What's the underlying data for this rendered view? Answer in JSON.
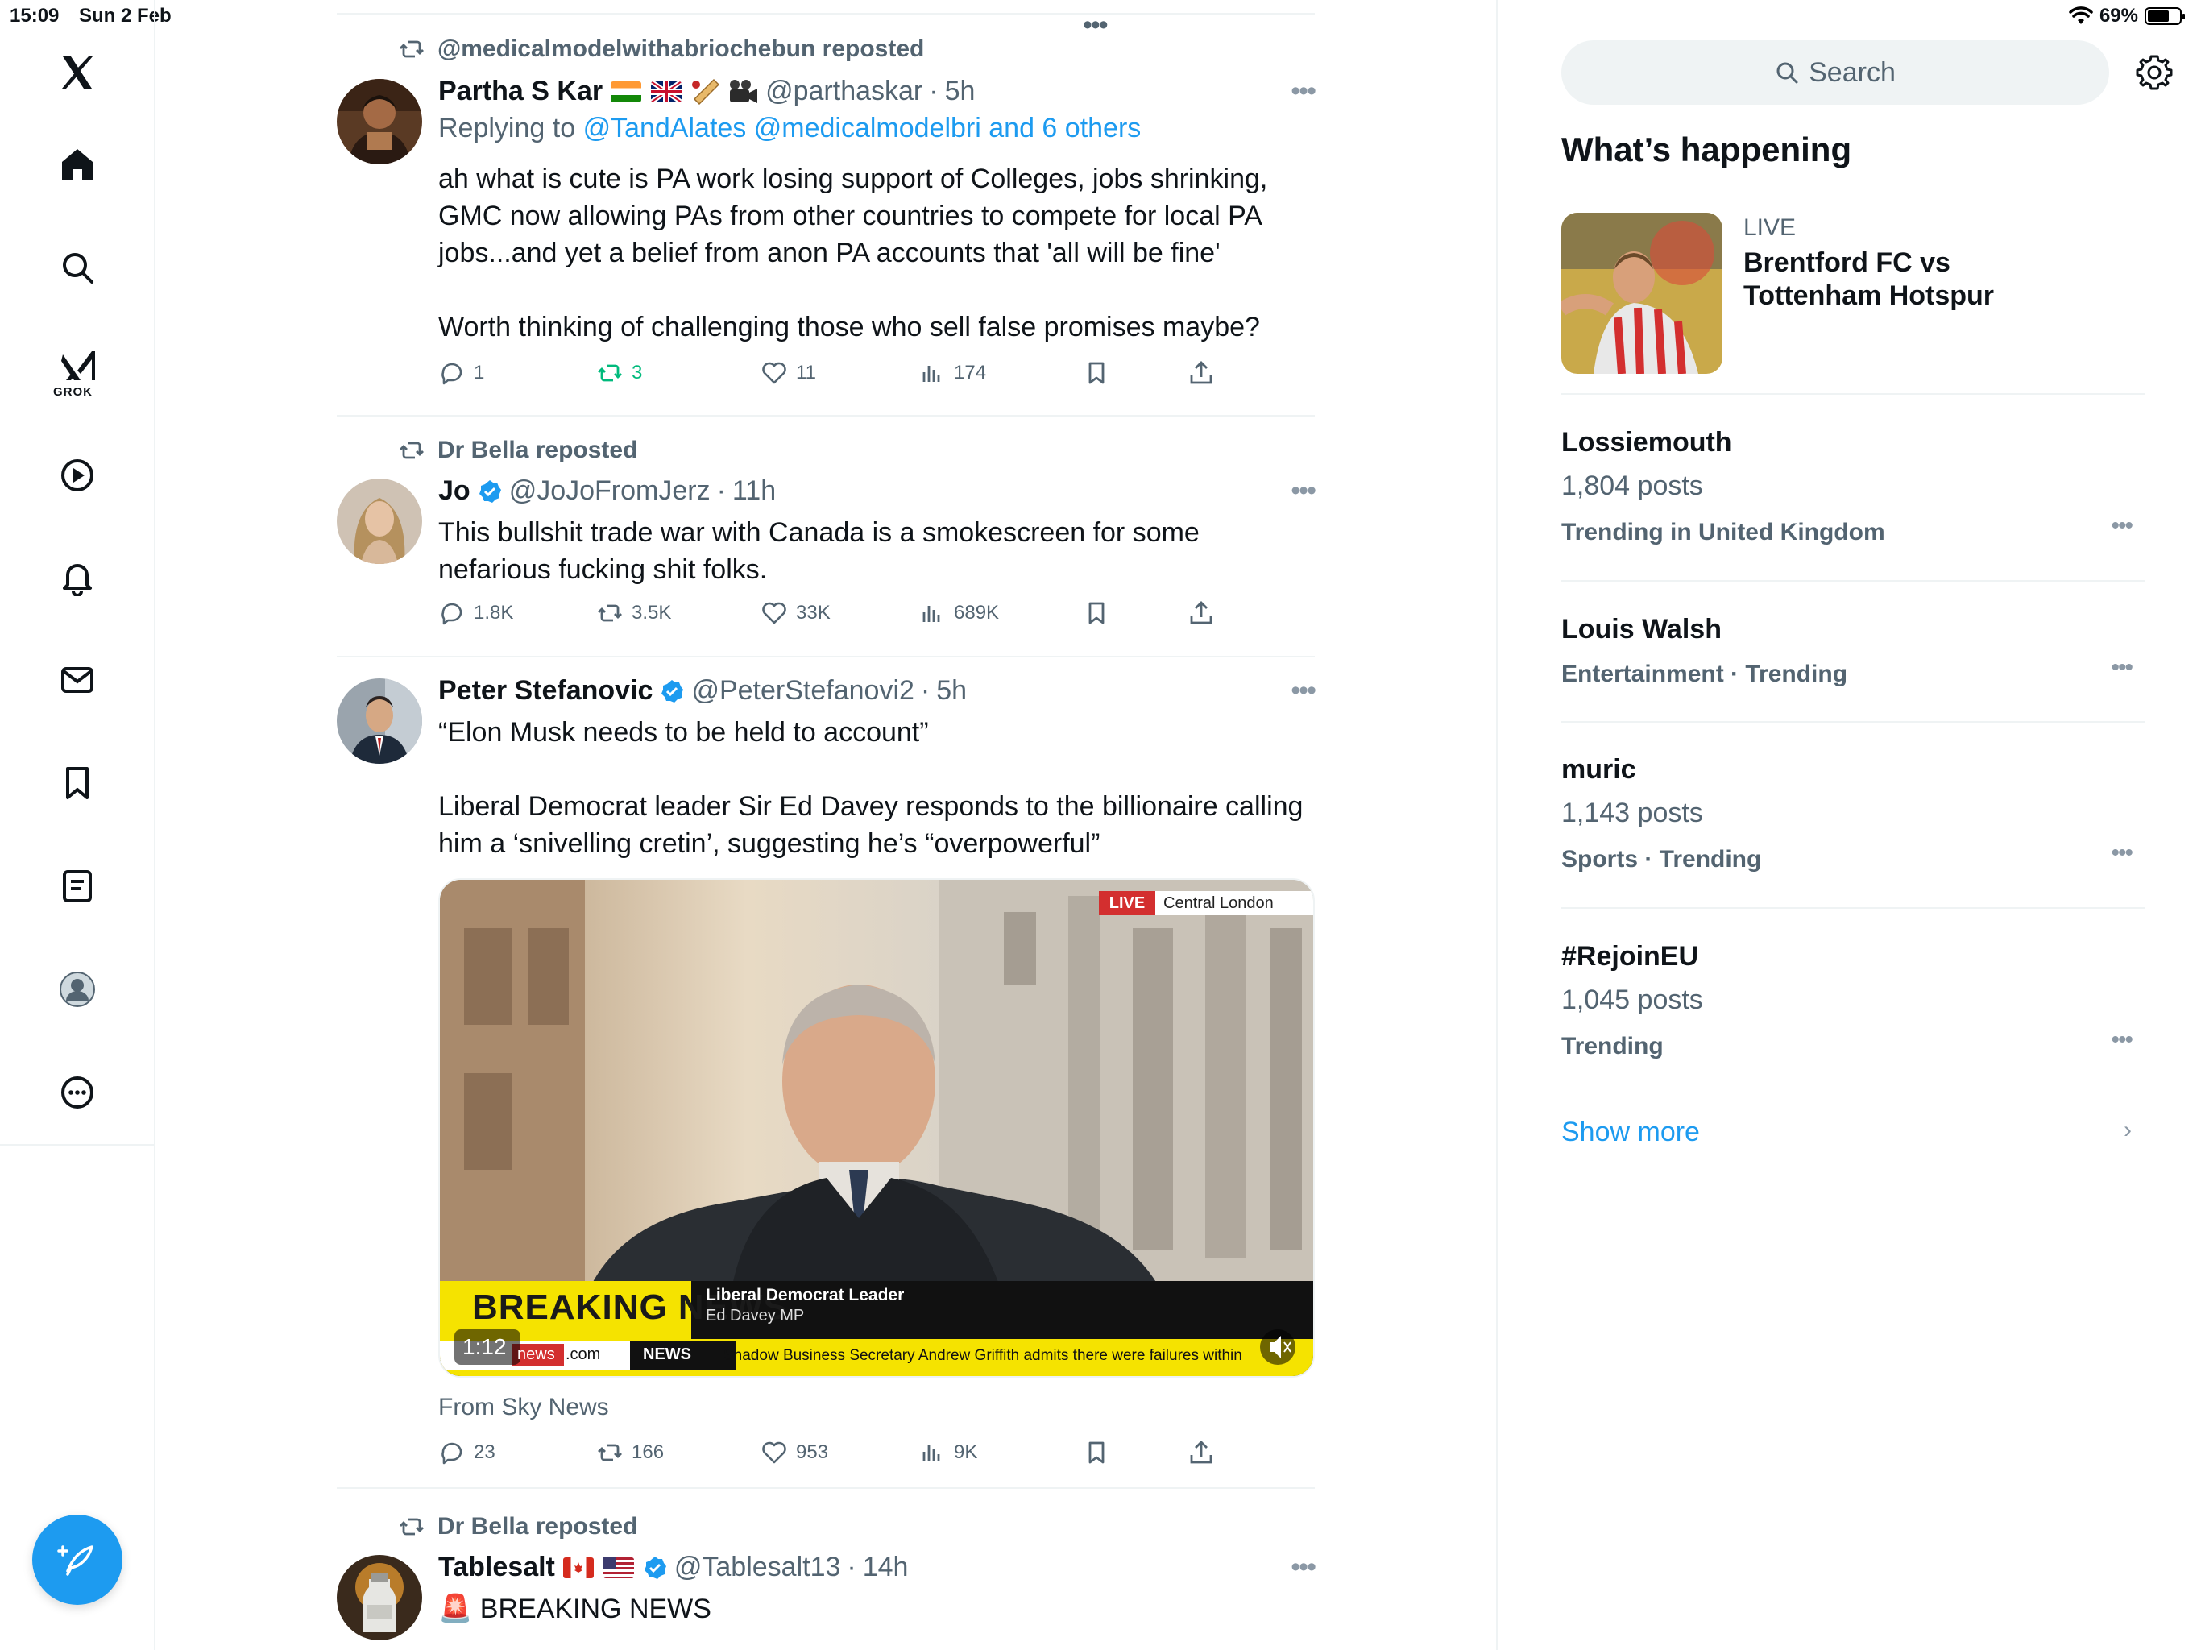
{
  "status_bar": {
    "time": "15:09",
    "date": "Sun 2 Feb",
    "battery": "69%",
    "battery_level": 0.69
  },
  "nav": {
    "items": [
      "x-logo",
      "home",
      "explore",
      "grok",
      "video",
      "notifications",
      "messages",
      "bookmarks",
      "lists",
      "profile",
      "more"
    ],
    "grok_label": "GROK"
  },
  "feed": {
    "tweets": [
      {
        "repost_by": "@medicalmodelwithabriochebun reposted",
        "name": "Partha S Kar",
        "handle": "@parthaskar",
        "time": "5h",
        "replying_prefix": "Replying to",
        "replying_links": "@TandAlates @medicalmodelbri and 6 others",
        "text_1": "ah what is cute is PA work losing support of Colleges, jobs shrinking, GMC now allowing PAs from other countries to compete for local PA jobs...and yet a belief from anon PA accounts that 'all will be fine'",
        "text_2": "Worth thinking of challenging those who sell false promises maybe?",
        "replies": "1",
        "reposts": "3",
        "likes": "11",
        "views": "174"
      },
      {
        "repost_by": "Dr Bella reposted",
        "name": "Jo",
        "handle": "@JoJoFromJerz",
        "time": "11h",
        "text_1": "This bullshit trade war with Canada is a smokescreen for some nefarious fucking shit folks.",
        "replies": "1.8K",
        "reposts": "3.5K",
        "likes": "33K",
        "views": "689K"
      },
      {
        "name": "Peter Stefanovic",
        "handle": "@PeterStefanovi2",
        "time": "5h",
        "text_1": "“Elon Musk needs to be held to account”",
        "text_2": "Liberal Democrat leader Sir Ed Davey responds to the billionaire calling him a ‘snivelling cretin’, suggesting he’s “overpowerful”",
        "video": {
          "live_badge": "LIVE",
          "location": "Central London",
          "breaking": "BREAKING NEWS",
          "caption_title": "Liberal Democrat Leader",
          "caption_sub": "Ed Davey MP",
          "duration": "1:12",
          "site_a": "news",
          "site_b": ".com",
          "ticker_label": "NEWS",
          "ticker_text": "Shadow Business Secretary Andrew Griffith admits there were failures within"
        },
        "source": "From Sky News",
        "replies": "23",
        "reposts": "166",
        "likes": "953",
        "views": "9K"
      },
      {
        "repost_by": "Dr Bella reposted",
        "name": "Tablesalt",
        "handle": "@Tablesalt13",
        "time": "14h",
        "text_1": "🚨 BREAKING NEWS"
      }
    ]
  },
  "sidebar": {
    "search_placeholder": "Search",
    "title": "What’s happening",
    "live_tag": "LIVE",
    "live_title": "Brentford FC vs Tottenham Hotspur",
    "trends": [
      {
        "name": "Lossiemouth",
        "count": "1,804 posts",
        "context": "Trending in United Kingdom"
      },
      {
        "name": "Louis Walsh",
        "count": "",
        "context": "Entertainment · Trending"
      },
      {
        "name": "muric",
        "count": "1,143 posts",
        "context": "Sports · Trending"
      },
      {
        "name": "#RejoinEU",
        "count": "1,045 posts",
        "context": "Trending"
      }
    ],
    "show_more": "Show more"
  },
  "colors": {
    "accent": "#1d9bf0",
    "secondary_text": "#536471",
    "repost_green": "#00ba7c",
    "border": "#eff3f4"
  }
}
